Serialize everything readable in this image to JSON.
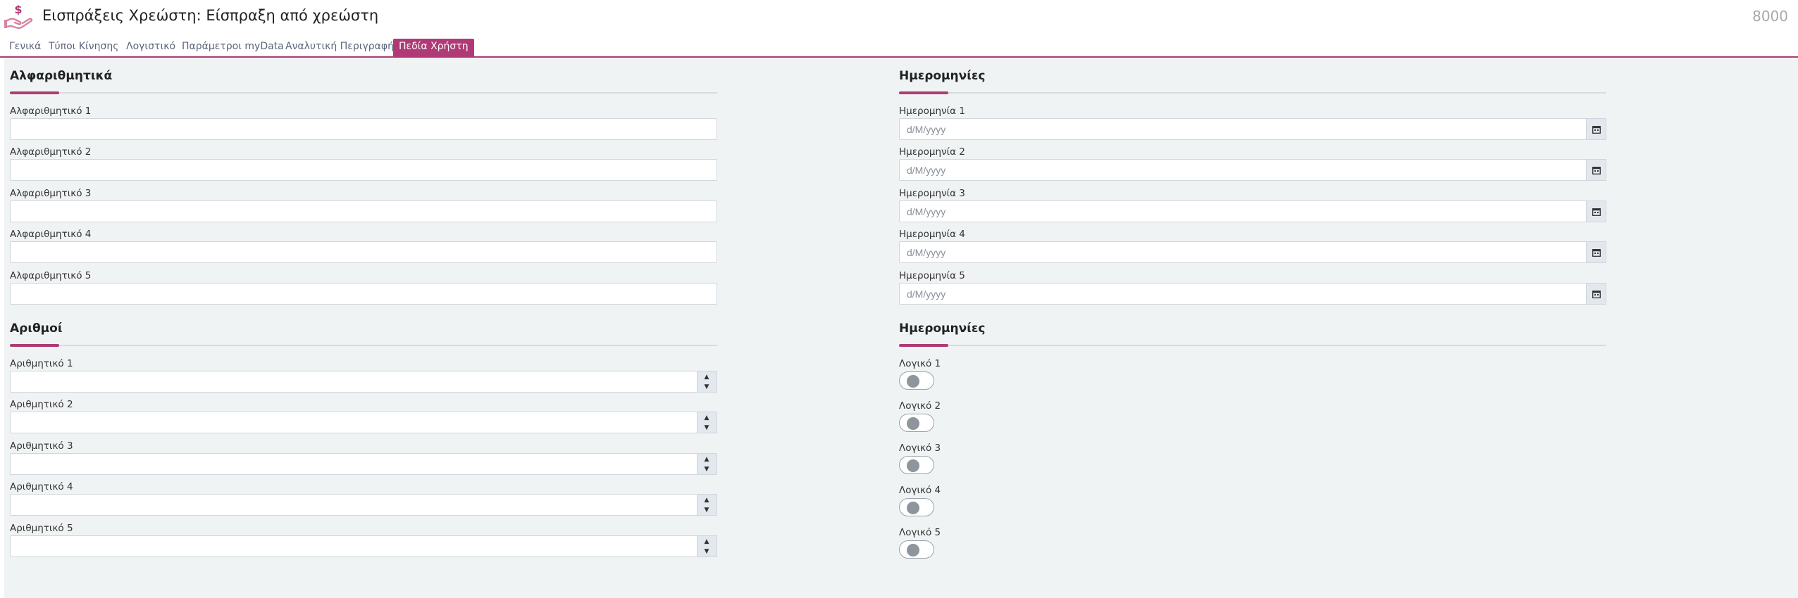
{
  "header": {
    "title": "Εισπράξεις Χρεώστη: Είσπραξη από χρεώστη",
    "code": "8000",
    "logo_icon": "hand-coin-icon",
    "accent_color": "#b03a75"
  },
  "tabs": [
    {
      "label": "Γενικά",
      "active": false
    },
    {
      "label": "Τύποι Κίνησης",
      "active": false
    },
    {
      "label": "Λογιστικό",
      "active": false
    },
    {
      "label": "Παράμετροι myData",
      "active": false
    },
    {
      "label": "Αναλυτική Περιγραφή",
      "active": false
    },
    {
      "label": "Πεδία Χρήστη",
      "active": true
    }
  ],
  "alpha_section": {
    "title": "Αλφαριθμητικά",
    "fields": [
      {
        "label": "Αλφαριθμητικό 1",
        "value": ""
      },
      {
        "label": "Αλφαριθμητικό 2",
        "value": ""
      },
      {
        "label": "Αλφαριθμητικό 3",
        "value": ""
      },
      {
        "label": "Αλφαριθμητικό 4",
        "value": ""
      },
      {
        "label": "Αλφαριθμητικό 5",
        "value": ""
      }
    ]
  },
  "date_section": {
    "title": "Ημερομηνίες",
    "placeholder": "d/M/yyyy",
    "fields": [
      {
        "label": "Ημερομηνία 1",
        "value": ""
      },
      {
        "label": "Ημερομηνία 2",
        "value": ""
      },
      {
        "label": "Ημερομηνία 3",
        "value": ""
      },
      {
        "label": "Ημερομηνία 4",
        "value": ""
      },
      {
        "label": "Ημερομηνία 5",
        "value": ""
      }
    ]
  },
  "number_section": {
    "title": "Αριθμοί",
    "fields": [
      {
        "label": "Αριθμητικό 1",
        "value": ""
      },
      {
        "label": "Αριθμητικό 2",
        "value": ""
      },
      {
        "label": "Αριθμητικό 3",
        "value": ""
      },
      {
        "label": "Αριθμητικό 4",
        "value": ""
      },
      {
        "label": "Αριθμητικό 5",
        "value": ""
      }
    ]
  },
  "bool_section": {
    "title": "Ημερομηνίες",
    "fields": [
      {
        "label": "Λογικό 1",
        "checked": false
      },
      {
        "label": "Λογικό 2",
        "checked": false
      },
      {
        "label": "Λογικό 3",
        "checked": false
      },
      {
        "label": "Λογικό 4",
        "checked": false
      },
      {
        "label": "Λογικό 5",
        "checked": false
      }
    ]
  }
}
